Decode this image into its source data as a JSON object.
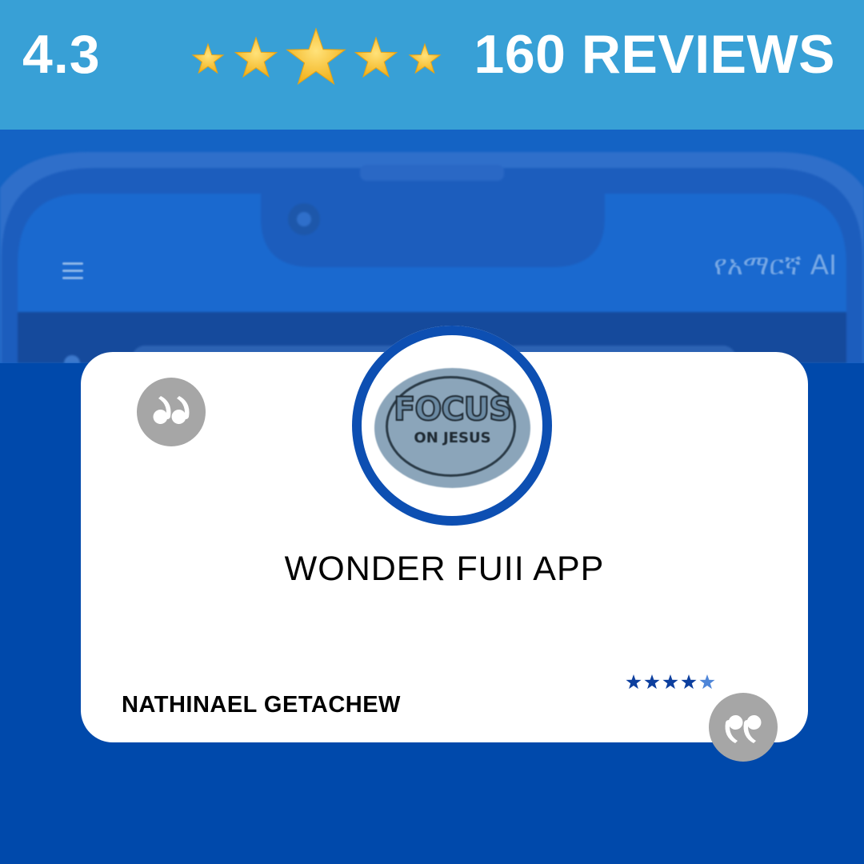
{
  "banner": {
    "rating": "4.3",
    "reviews": "160 REVIEWS",
    "stars_count": 5,
    "star_color": "#f8c33a",
    "background": "#38a0d6"
  },
  "phone_backdrop": {
    "app_title": "የአማርኛ AI",
    "menu_icon": "hamburger-menu-icon"
  },
  "review": {
    "avatar_logo_text_line1": "FOCUS",
    "avatar_logo_text_line2": "ON JESUS",
    "app_name": "WONDER FUII APP",
    "reviewer": "NATHINAEL GETACHEW",
    "stars_count": 5,
    "star_color": "#0d3f9e",
    "quote_icon": "quote-mark-icon"
  },
  "colors": {
    "page_background": "#0049ab",
    "accent_ring": "#0d4fb2",
    "quote_badge": "#a6a6a6"
  }
}
